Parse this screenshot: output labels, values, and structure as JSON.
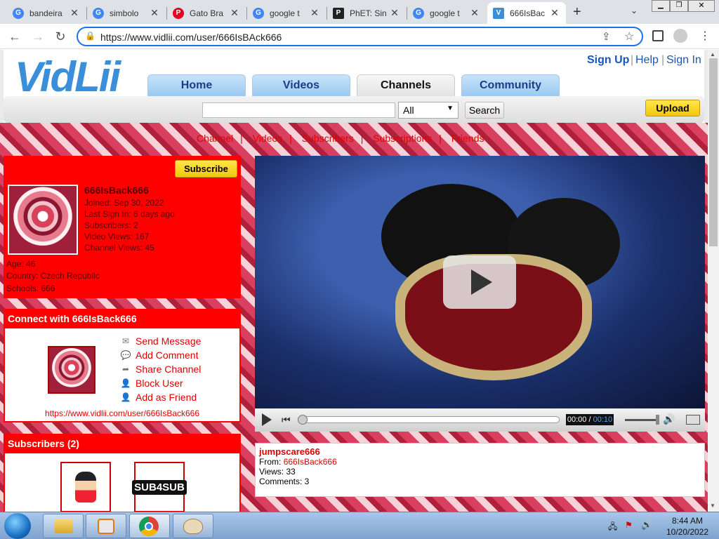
{
  "browser": {
    "tabs": [
      {
        "title": "bandeira",
        "favicon": "google-icon",
        "active": false
      },
      {
        "title": "simbolo",
        "favicon": "google-icon",
        "active": false
      },
      {
        "title": "Gato Bra",
        "favicon": "pinterest-icon",
        "active": false
      },
      {
        "title": "google t",
        "favicon": "google-icon",
        "active": false
      },
      {
        "title": "PhET: Sin",
        "favicon": "phet-icon",
        "active": false
      },
      {
        "title": "google t",
        "favicon": "google-icon",
        "active": false
      },
      {
        "title": "666IsBac",
        "favicon": "vidlii-icon",
        "active": true
      }
    ],
    "url": "https://www.vidlii.com/user/666IsBAck666"
  },
  "site": {
    "logo": "VidLii",
    "top_links": {
      "signup": "Sign Up",
      "help": "Help",
      "signin": "Sign In"
    },
    "nav": [
      "Home",
      "Videos",
      "Channels",
      "Community"
    ],
    "nav_selected": "Channels",
    "search": {
      "value": "",
      "category": "All",
      "button": "Search"
    },
    "upload": "Upload"
  },
  "channel": {
    "subnav": [
      "Channel",
      "Videos",
      "Subscribers",
      "Subscriptions",
      "Friends"
    ],
    "subscribe": "Subscribe",
    "username": "666IsBack666",
    "joined": "Joined: Sep 30, 2022",
    "last_sign_in": "Last Sign In: 6 days ago",
    "subscribers": "Subscribers: 2",
    "video_views": "Video Views: 167",
    "channel_views": "Channel Views: 45",
    "age": "Age: 46",
    "country": "Country: Czech Republic",
    "schools": "Schools: 666"
  },
  "connect": {
    "header": "Connect with 666IsBack666",
    "links": [
      {
        "label": "Send Message",
        "icon": "envelope-icon"
      },
      {
        "label": "Add Comment",
        "icon": "comment-icon"
      },
      {
        "label": "Share Channel",
        "icon": "share-icon"
      },
      {
        "label": "Block User",
        "icon": "user-block-icon"
      },
      {
        "label": "Add as Friend",
        "icon": "user-add-icon"
      }
    ],
    "channel_url": "https://www.vidlii.com/user/666IsBack666"
  },
  "subscribers_box": {
    "header": "Subscribers (2)",
    "thumb2_text": "SUB4SUB"
  },
  "player": {
    "time_current": "00:00",
    "time_total": "00:10",
    "progress": 0
  },
  "video": {
    "title": "jumpscare666",
    "from_label": "From:",
    "from_user": "666IsBack666",
    "views": "Views: 33",
    "comments": "Comments: 3"
  },
  "taskbar": {
    "time": "8:44 AM",
    "date": "10/20/2022"
  },
  "colors": {
    "brand_red": "#ff0000",
    "link_blue": "#1a55b8",
    "upload_yellow": "#f2c80c"
  }
}
